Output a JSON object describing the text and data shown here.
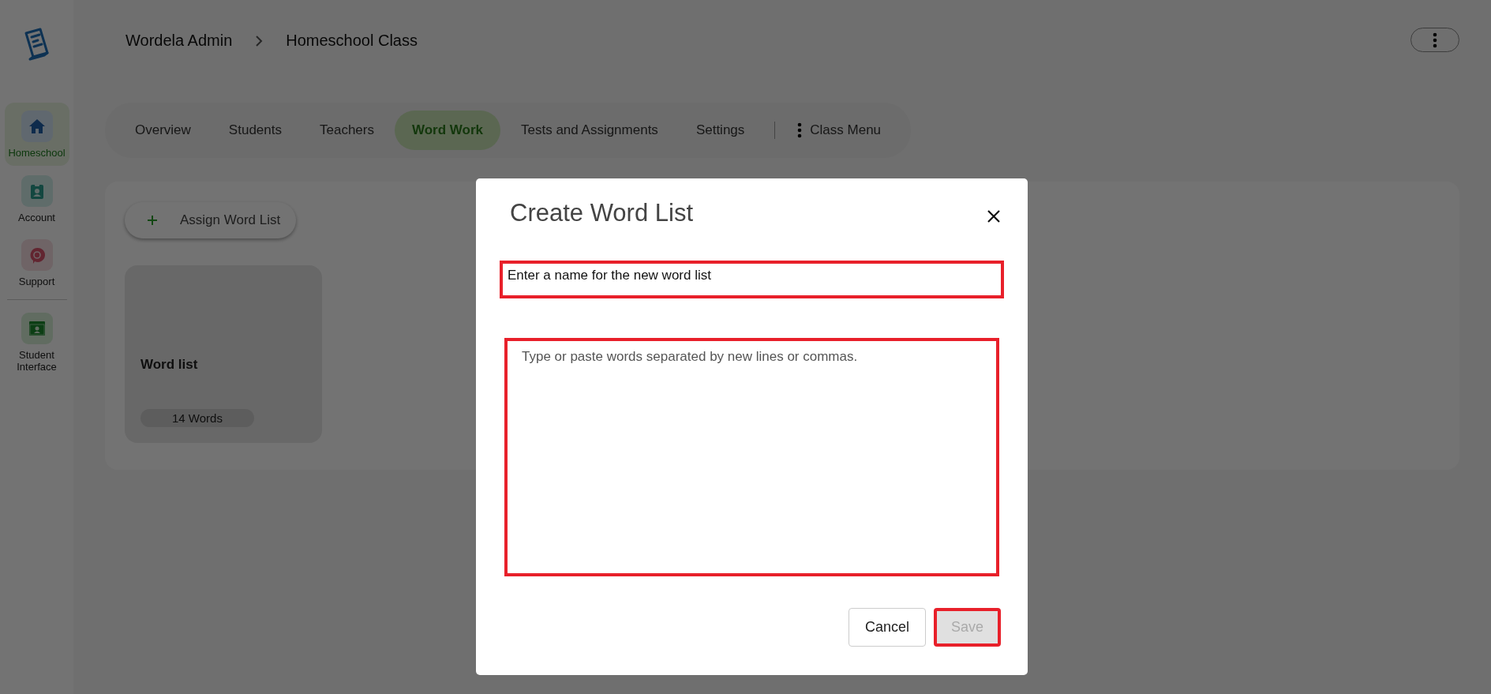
{
  "sidebar": {
    "items": [
      {
        "label": "Homeschool",
        "kind": "home",
        "selected": true
      },
      {
        "label": "Account",
        "kind": "account",
        "selected": false
      },
      {
        "label": "Support",
        "kind": "support",
        "selected": false
      },
      {
        "label": "Student Interface",
        "kind": "student",
        "selected": false
      }
    ]
  },
  "breadcrumb": [
    "Wordela Admin",
    "Homeschool Class"
  ],
  "tabs": [
    {
      "label": "Overview",
      "selected": false
    },
    {
      "label": "Students",
      "selected": false
    },
    {
      "label": "Teachers",
      "selected": false
    },
    {
      "label": "Word Work",
      "selected": true
    },
    {
      "label": "Tests and Assignments",
      "selected": false
    },
    {
      "label": "Settings",
      "selected": false
    }
  ],
  "class_menu": "Class Menu",
  "assign_button": "Assign Word List",
  "word_lists": [
    {
      "title": "Word list",
      "count": "14 Words"
    }
  ],
  "dialog": {
    "title": "Create Word List",
    "name_field": {
      "placeholder": "Enter a name for the new word list",
      "highlighted": true
    },
    "words_field": {
      "placeholder": "Type or paste words separated by new lines or commas.",
      "highlighted": true
    },
    "cancel_button": {
      "label": "Cancel"
    },
    "save_button": {
      "label": "Save",
      "disabled": true,
      "highlighted": true
    }
  }
}
